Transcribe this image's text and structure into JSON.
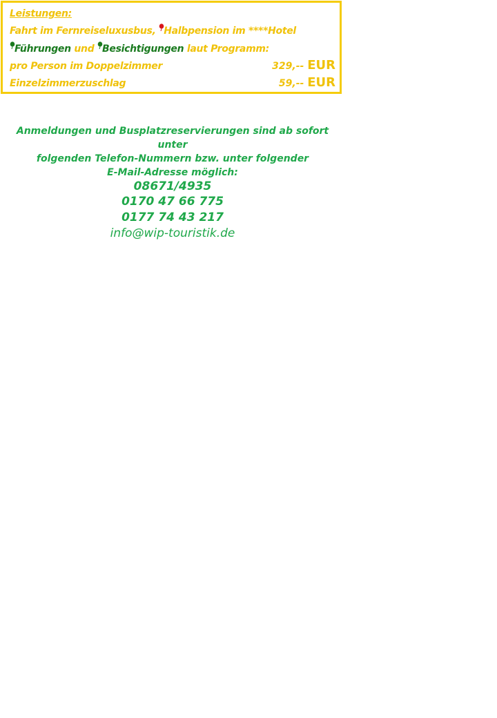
{
  "services": {
    "heading": "Leistungen:",
    "line1": {
      "text_a": "Fahrt im Fernreiseluxusbus, ",
      "bullet_icon": "red-balloon-icon",
      "text_b": "Halbpension im ****Hotel"
    },
    "line2": {
      "bullet1_icon": "green-balloon-icon",
      "item1": "Führungen",
      "conj": " und ",
      "bullet2_icon": "green-balloon-icon",
      "item2": "Besichtigungen",
      "suffix": " laut Programm:"
    },
    "double_room": {
      "label": "pro Person im Doppelzimmer",
      "amount": "329,-- ",
      "currency": "EUR"
    },
    "single_supplement": {
      "label": "Einzelzimmerzuschlag",
      "amount": "59,-- ",
      "currency": "EUR"
    }
  },
  "contact": {
    "intro_line1": "Anmeldungen und Busplatzreservierungen sind ab sofort unter",
    "intro_line2": "folgenden Telefon-Nummern bzw. unter folgender",
    "intro_line3": "E-Mail-Adresse möglich:",
    "phones": [
      "08671/4935",
      "0170 47 66 775",
      "0177 74 43 217"
    ],
    "email": "info@wip-touristik.de"
  },
  "colors": {
    "box_border": "#f5cc0c",
    "yellow_text": "#f0c20a",
    "dark_green_text": "#1a7a1f",
    "contact_green": "#1fa84a",
    "balloon_red": "#d8161b"
  }
}
